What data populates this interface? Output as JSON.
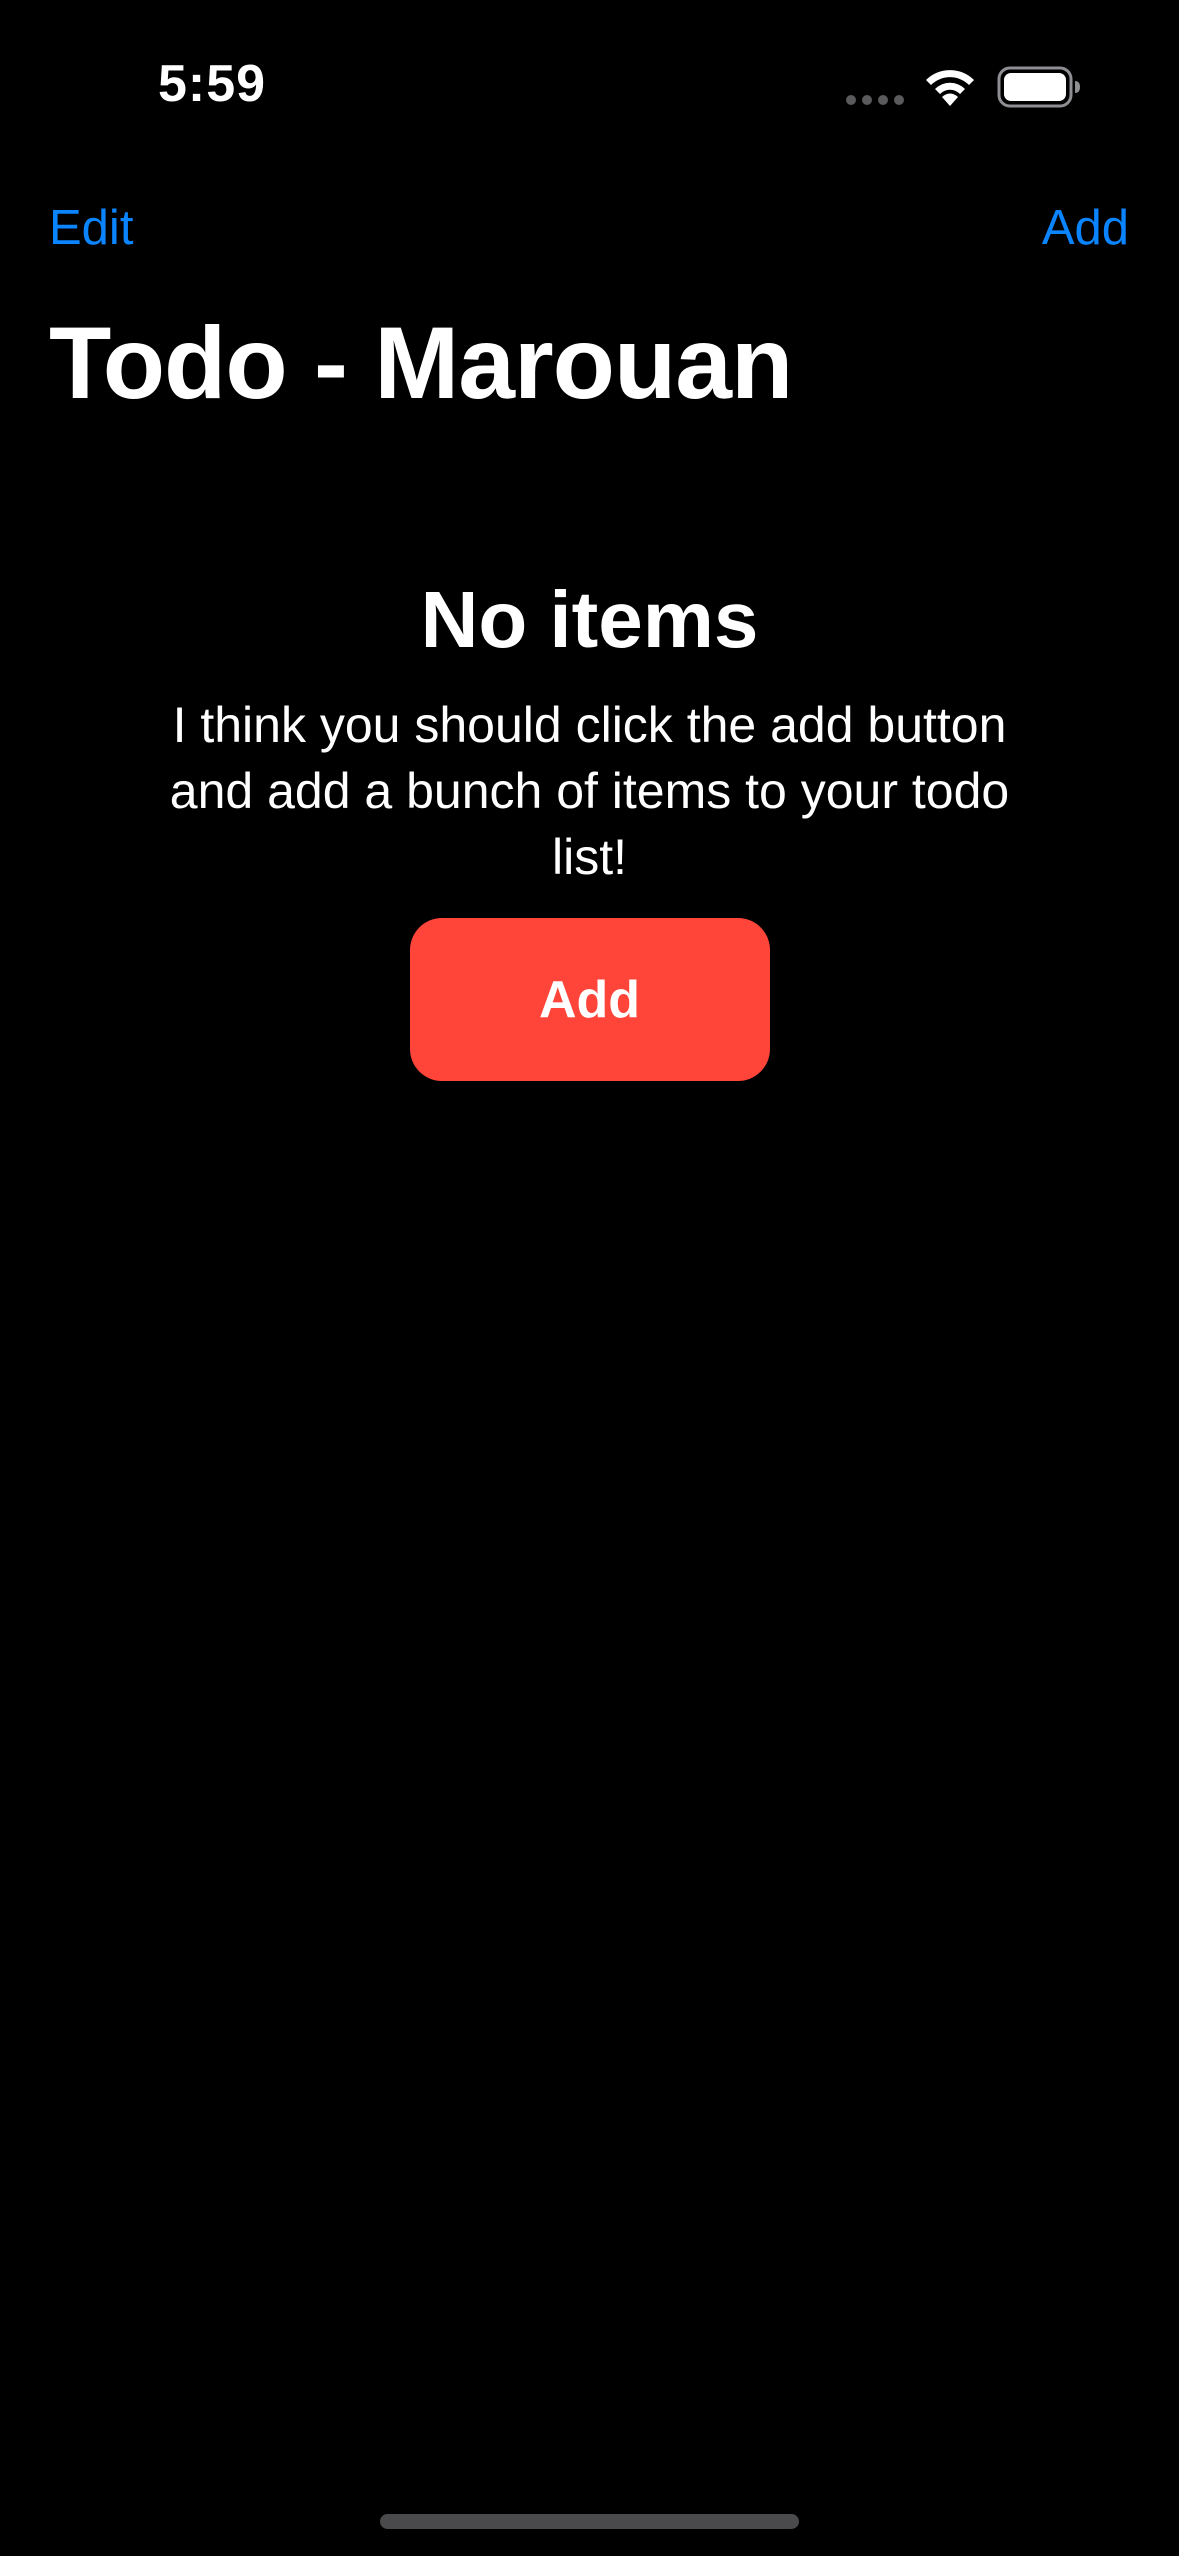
{
  "status_bar": {
    "time": "5:59",
    "icons": [
      "cellular-signal-icon",
      "wifi-icon",
      "battery-icon"
    ]
  },
  "nav": {
    "edit_label": "Edit",
    "add_label": "Add"
  },
  "page": {
    "title": "Todo - Marouan"
  },
  "empty_state": {
    "title": "No items",
    "message": "I think you should click the add button and add a bunch of items to your todo list!",
    "button_label": "Add"
  },
  "colors": {
    "background": "#000000",
    "accent": "#0a84ff",
    "button": "#ff453a",
    "text": "#ffffff"
  }
}
